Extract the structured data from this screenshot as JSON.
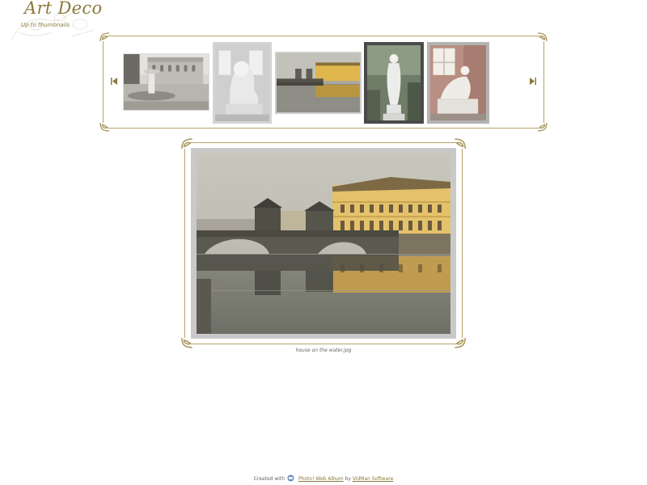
{
  "header": {
    "title": "Art Deco",
    "up_link": "Up to thumbnails"
  },
  "filmstrip": {
    "prev_icon": "prev-arrow-icon",
    "next_icon": "next-arrow-icon",
    "thumbnails": [
      {
        "subject": "fountain-palace"
      },
      {
        "subject": "lion-statue"
      },
      {
        "subject": "bridge-water"
      },
      {
        "subject": "venus-statue"
      },
      {
        "subject": "crouching-statue"
      }
    ],
    "selected_index": 2
  },
  "photo": {
    "caption": "house on the water.jpg"
  },
  "footer": {
    "created_with": "Created with",
    "app_link": "Photo! Web Album",
    "by": "by",
    "company_link": "VidMan Software"
  },
  "colors": {
    "accent": "#8a7a3a",
    "frame_line": "#b6a56a",
    "mat": "#c9c9c9"
  }
}
